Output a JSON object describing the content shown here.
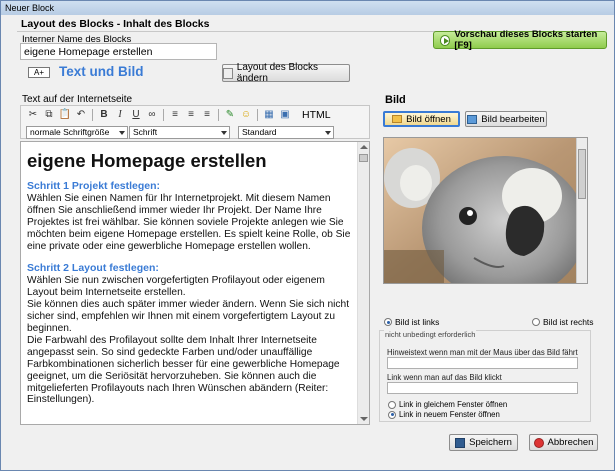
{
  "window": {
    "title": "Neuer Block"
  },
  "header": {
    "title": "Layout des Blocks - Inhalt des Blocks",
    "preview_button": "Vorschau dieses Blocks starten [F9]"
  },
  "block_name": {
    "label": "Interner Name des Blocks",
    "value": "eigene Homepage erstellen"
  },
  "block_type": {
    "icon_text": "A+",
    "label": "Text und Bild",
    "change_layout_button": "Layout des Blocks ändern"
  },
  "editor": {
    "label": "Text auf der Internetseite",
    "toolbar_html_label": "HTML",
    "font_size": "normale Schriftgröße",
    "font": "Schrift",
    "style": "Standard",
    "heading": "eigene Homepage erstellen",
    "step1_title": "Schritt 1 Projekt festlegen:",
    "step1_text": "Wählen Sie einen Namen für Ihr Internetprojekt. Mit diesem Namen öffnen Sie anschließend immer wieder Ihr Projekt. Der Name Ihre Projektes ist frei wählbar. Sie können soviele Projekte anlegen wie Sie möchten beim eigene Homepage erstellen. Es spielt keine Rolle, ob Sie eine private oder eine gewerbliche Homepage erstellen wollen.",
    "step2_title": "Schritt 2 Layout festlegen:",
    "step2_text1": "Wählen Sie nun zwischen vorgefertigten Profilayout oder eigenem Layout beim Internetseite erstellen.",
    "step2_text2": "Sie können dies auch später immer wieder ändern. Wenn Sie sich nicht sicher sind, empfehlen wir Ihnen mit einem vorgefertigtem Layout zu beginnen.",
    "step2_text3": "Die Farbwahl des Profilayout sollte dem Inhalt Ihrer Internetseite angepasst sein. So sind gedeckte Farben und/oder unauffällige Farbkombinationen sicherlich besser für eine gewerbliche Homepage geeignet, um die Seriösität hervorzuheben. Sie können auch die mitgelieferten Profilayouts nach Ihren Wünschen abändern (Reiter: Einstellungen)."
  },
  "image_panel": {
    "title": "Bild",
    "open_button": "Bild öffnen",
    "edit_button": "Bild bearbeiten",
    "position_left": "Bild ist links",
    "position_right": "Bild ist rechts",
    "optional_group": "nicht unbedingt erforderlich",
    "hover_label": "Hinweistext wenn man mit der Maus über das Bild fährt",
    "link_label": "Link wenn man auf das Bild klickt",
    "link_same_window": "Link in gleichem Fenster öffnen",
    "link_new_window": "Link in neuem Fenster öffnen"
  },
  "footer": {
    "save_button": "Speichern",
    "cancel_button": "Abbrechen"
  }
}
